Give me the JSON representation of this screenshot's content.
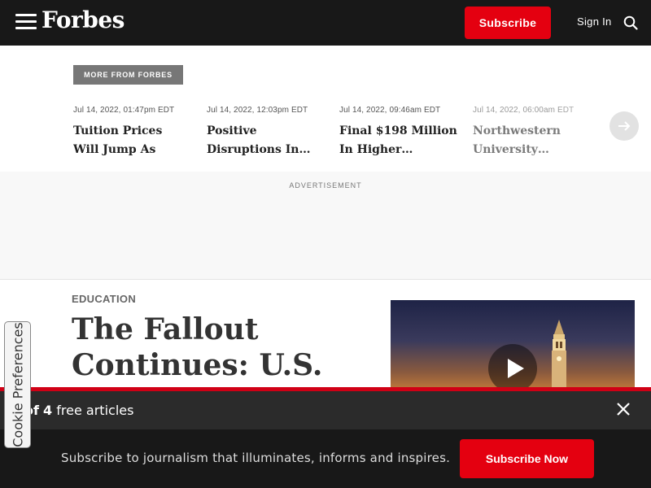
{
  "header": {
    "logo_text": "Forbes",
    "subscribe_label": "Subscribe",
    "signin_label": "Sign In",
    "icons": [
      "menu-icon",
      "search-icon"
    ],
    "colors": {
      "background": "#181818",
      "accent": "#e40010"
    }
  },
  "more_from_forbes": {
    "badge": "MORE FROM FORBES",
    "cards": [
      {
        "date": "Jul 14, 2022, 01:47pm EDT",
        "title": "Tuition Prices Will Jump As Colleges…"
      },
      {
        "date": "Jul 14, 2022, 12:03pm EDT",
        "title": "Positive Disruptions In…"
      },
      {
        "date": "Jul 14, 2022, 09:46am EDT",
        "title": "Final $198 Million In Higher…"
      },
      {
        "date": "Jul 14, 2022, 06:00am EDT",
        "title": "Northwestern University…"
      }
    ]
  },
  "advertisement": {
    "label": "ADVERTISEMENT"
  },
  "article": {
    "section": "EDUCATION",
    "headline": "The Fallout Continues: U.S. Enrollment"
  },
  "paywall": {
    "meter_prefix": "of",
    "meter_total": "4",
    "meter_suffix": "free articles",
    "message": "Subscribe to journalism that illuminates, informs and inspires.",
    "subscribe_now_label": "Subscribe Now"
  },
  "cookie": {
    "label": "Cookie Preferences"
  }
}
